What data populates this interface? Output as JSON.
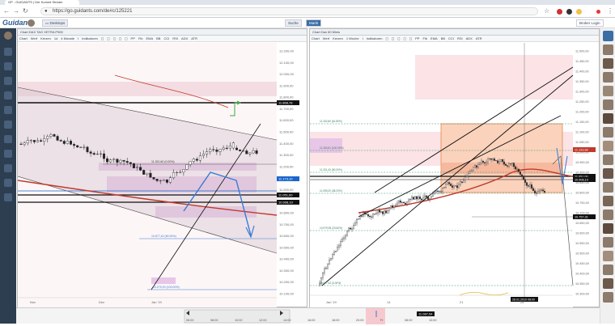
{
  "browser": {
    "tab_title": "GP - GUIDANTS | Der Kommt Stream",
    "url": "https://go.guidants.com/de#c/125221",
    "lock": "lock-icon"
  },
  "app": {
    "logo": "Guidants",
    "desktop_btn": "Desktops",
    "search_btn": "Suche",
    "market_btn": "Markt",
    "broker_btn": "Broker Login"
  },
  "left_chart": {
    "header": "Chart DAX TAG XETRA P900",
    "toolbar": [
      "Chart",
      "Werf",
      "Kerzen",
      "1d",
      "4 Monate",
      "I",
      "Indikatoren",
      "",
      "",
      "",
      "",
      "",
      "PP",
      "Fib",
      "EMA",
      "BB",
      "CCI",
      "RSI",
      "ADX",
      "ATR"
    ],
    "info": [
      "DAX (XETRA, Last)  O: 11.257,82  H: 11.311,07  L: 11.151,11  C: 11.173,10",
      "EMA(200)  11.156,24",
      "01.10.2018 - 11.01.2019  (1 Monate, 1 Tag)"
    ],
    "price_labels": [
      "12.200,00",
      "12.100,00",
      "12.000,00",
      "11.900,00",
      "11.800,00",
      "11.700,00",
      "11.600,00",
      "11.500,00",
      "11.400,00",
      "11.300,00",
      "11.200,00",
      "11.100,00",
      "11.000,00",
      "10.900,00",
      "10.800,00",
      "10.700,00",
      "10.600,00",
      "10.500,00",
      "10.400,00",
      "10.300,00",
      "10.200,00",
      "10.100,00"
    ],
    "tags": [
      "11.868,78",
      "11.173,10",
      "11.051,00",
      "10.908,10"
    ],
    "annotations": [
      "11.321,60 (0.00%)",
      "10.677,42 (60.00%)",
      "10.279,20 (100.00%)"
    ],
    "xlabels": [
      "Nov",
      "Dez",
      "Jan '19"
    ]
  },
  "right_chart": {
    "header": "Chart Dax 60 Minis",
    "toolbar": [
      "Chart",
      "Werf",
      "Kerzen",
      "1 Woche",
      "I",
      "Indikatoren",
      "",
      "",
      "",
      "",
      "",
      "PP",
      "Fib",
      "EMA",
      "BB",
      "CCI",
      "RSI",
      "ADX",
      "ATR"
    ],
    "info": [
      "DAX (XETRA, Last)  O: 11.191,52  H: 11.214,90  L: 11.166,17  C: 11.213,60",
      "EMA(200)  10.984,97",
      "27.12.2018 10:00 - 08.02.2019 16:00  (1 Woche, 1 Stunde)"
    ],
    "price_labels": [
      "11.500,00",
      "11.450,00",
      "11.400,00",
      "11.350,00",
      "11.300,00",
      "11.250,00",
      "11.200,00",
      "11.150,00",
      "11.100,00",
      "11.050,00",
      "11.000,00",
      "10.950,00",
      "10.900,00",
      "10.850,00",
      "10.800,00",
      "10.750,00",
      "10.700,00",
      "10.650,00",
      "10.600,00",
      "10.550,00",
      "10.500,00",
      "10.450,00",
      "10.400,00",
      "10.350,00",
      "10.300,00"
    ],
    "tags": [
      "11.133,98",
      "11.051,00",
      "10.908,10",
      "10.757,31"
    ],
    "annotations": [
      "11.332,80 (61.80%)",
      "11.263,61 (100.00%)",
      "11.201,40 (50.00%)",
      "11.059,20 (38.20%)",
      "10.979,95 (23.60%)",
      "10.677,42 (0.00%)"
    ],
    "cursor_date": "28.01.2019 08:00",
    "xlabels": [
      "Jan '19",
      "14",
      "21",
      "28"
    ]
  },
  "bottom": {
    "times": [
      "06:00",
      "08:00",
      "10:00",
      "12:00",
      "14:00",
      "16:00",
      "18:00",
      "20:00",
      "Fr",
      "08:00",
      "10:00"
    ],
    "price_badge": "11.087,54"
  }
}
